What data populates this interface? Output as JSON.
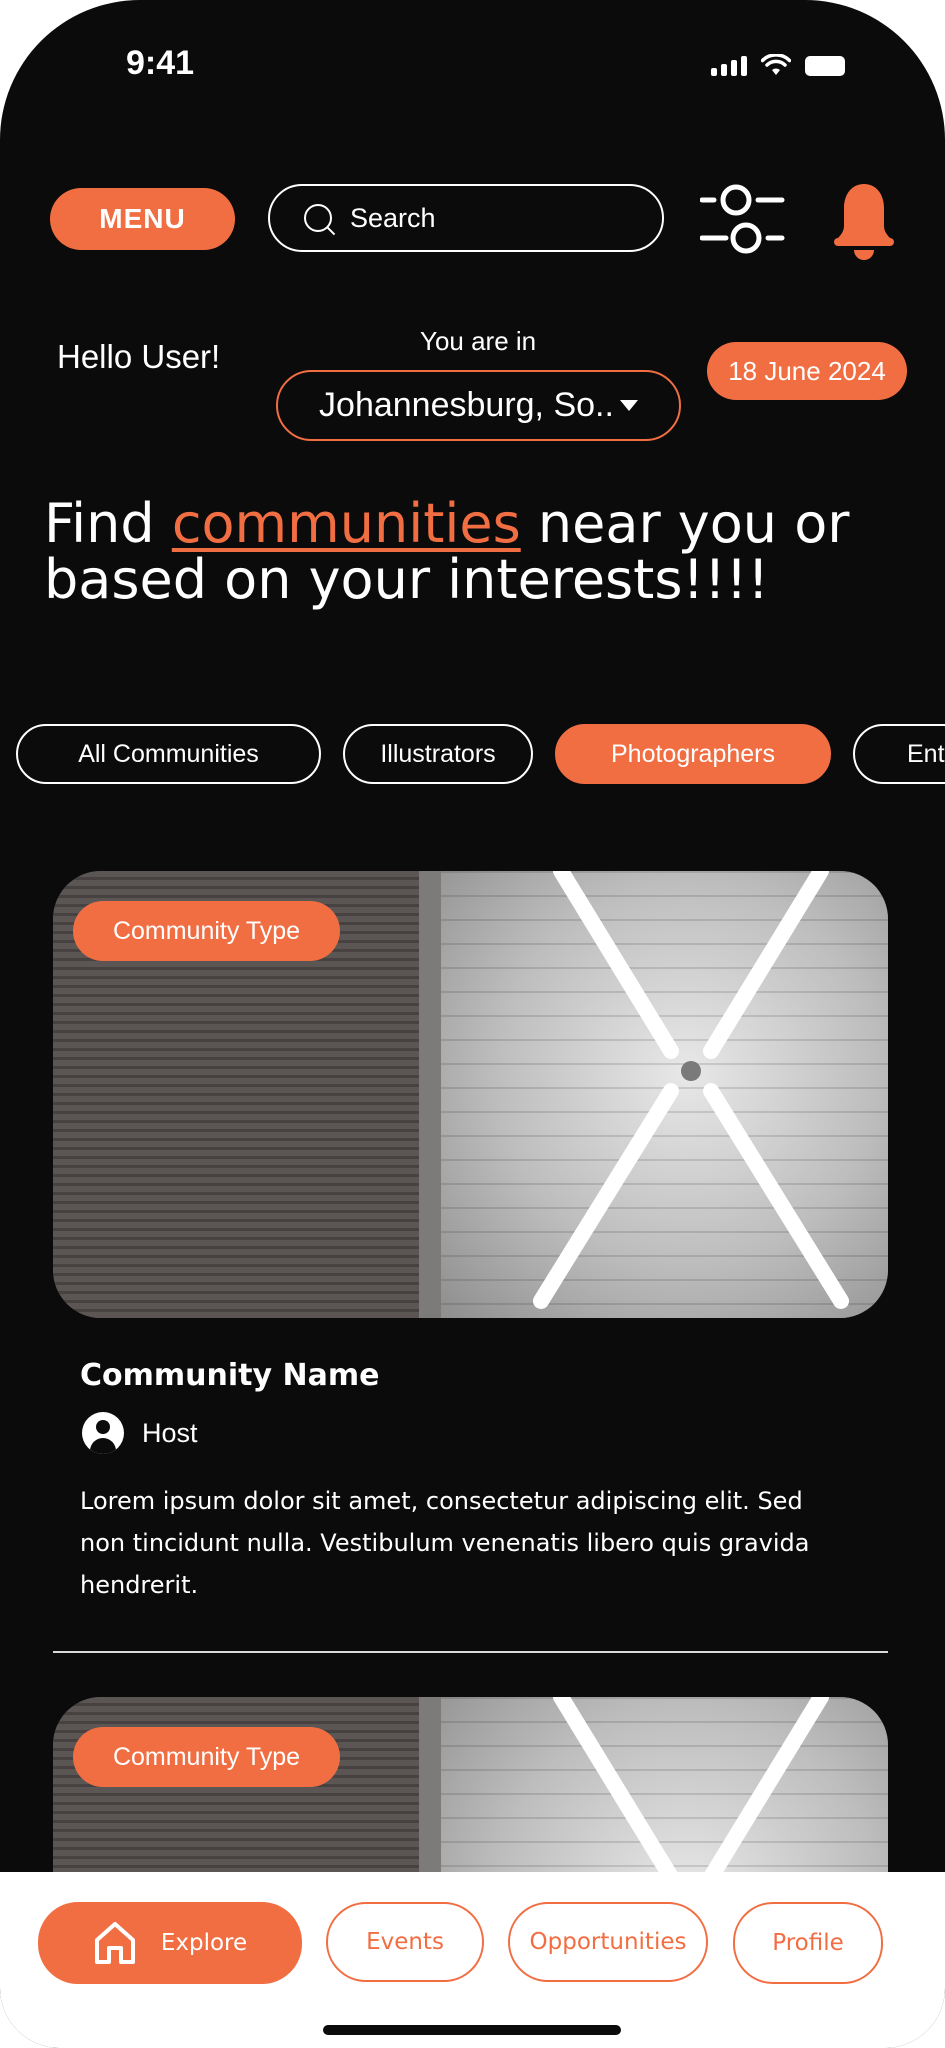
{
  "status_bar": {
    "time": "9:41"
  },
  "header": {
    "menu_label": "MENU",
    "search_placeholder": "Search"
  },
  "greeting": {
    "hello": "Hello User!",
    "you_are_in": "You are in",
    "location": "Johannesburg, So..",
    "date": "18 June 2024"
  },
  "headline": {
    "part1": "Find ",
    "highlight": "communities",
    "part2": " near you or based on your interests!!!!"
  },
  "chips": [
    {
      "label": "All Communities",
      "active": false
    },
    {
      "label": "Illustrators",
      "active": false
    },
    {
      "label": "Photographers",
      "active": true
    },
    {
      "label": "Ent",
      "active": false
    }
  ],
  "cards": [
    {
      "type": "Community Type",
      "name": "Community Name",
      "host": "Host",
      "description": "Lorem ipsum dolor sit amet, consectetur adipiscing elit. Sed non tincidunt nulla. Vestibulum venenatis libero quis gravida hendrerit."
    },
    {
      "type": "Community Type"
    }
  ],
  "bottom_nav": {
    "explore": "Explore",
    "events": "Events",
    "opportunities": "Opportunities",
    "profile": "Profile"
  },
  "colors": {
    "accent": "#f16e43",
    "background": "#0b0b0b",
    "nav_background": "#ffffff"
  }
}
